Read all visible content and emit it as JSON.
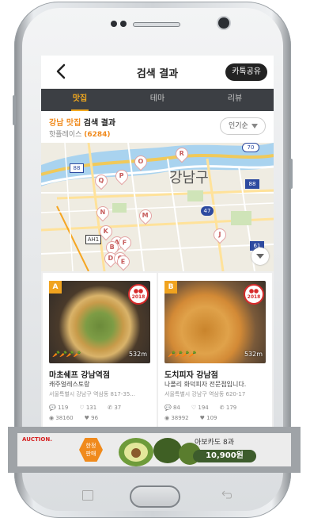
{
  "header": {
    "title": "검색 결과",
    "share_label": "카톡공유"
  },
  "tabs": [
    {
      "label": "맛집",
      "active": true
    },
    {
      "label": "테마",
      "active": false
    },
    {
      "label": "리뷰",
      "active": false
    }
  ],
  "result": {
    "title_highlight": "강남 맛집",
    "title_rest": " 검색 결과",
    "sub_prefix": "핫플레이스 ",
    "count": "(6284)",
    "sort_label": "인기순"
  },
  "map": {
    "district_label": "강남구",
    "route_labels": [
      "70",
      "88",
      "88",
      "47",
      "61",
      "AH1"
    ],
    "pins": [
      "R",
      "O",
      "Q",
      "P",
      "N",
      "M",
      "K",
      "A",
      "F",
      "B",
      "D",
      "C",
      "E",
      "J"
    ]
  },
  "cards": [
    {
      "badge": "A",
      "award_year": "2018",
      "distance": "532m",
      "name": "마초쉐프 강남역점",
      "desc": "캐주얼레스토랑",
      "address": "서울특별시 강남구 역삼동 817-35...",
      "stats": {
        "reviews": "119",
        "likes": "131",
        "calls": "37",
        "views": "38160",
        "hearts": "96"
      }
    },
    {
      "badge": "B",
      "award_year": "2018",
      "distance": "532m",
      "name": "도치피자 강남점",
      "desc": "나폴리 화덕피자 전문점입니다.",
      "address": "서울특별시 강남구 역삼동 620-17",
      "stats": {
        "reviews": "84",
        "likes": "194",
        "calls": "179",
        "views": "38992",
        "hearts": "109"
      }
    }
  ],
  "ad": {
    "brand": "AUCTION.",
    "tag_line1": "한정",
    "tag_line2": "판매",
    "product": "아보카도 8과",
    "price": "10,900원"
  },
  "colors": {
    "accent": "#f08a1c",
    "tab_bg": "#3c3f44",
    "tab_active": "#f3a91e"
  }
}
